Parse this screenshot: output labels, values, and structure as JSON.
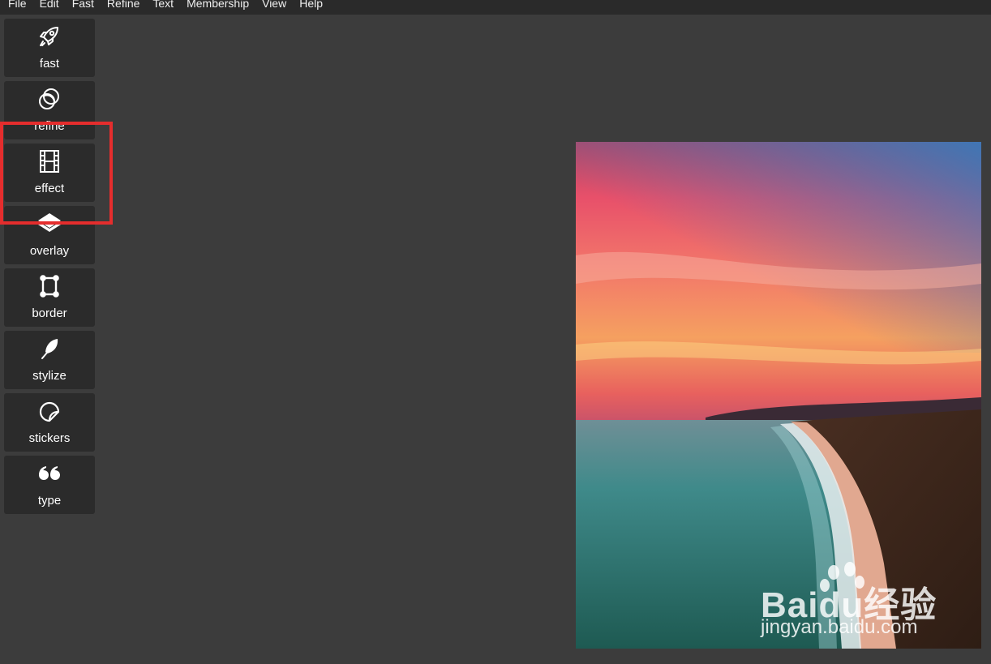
{
  "menubar": {
    "items": [
      {
        "label": "File"
      },
      {
        "label": "Edit"
      },
      {
        "label": "Fast"
      },
      {
        "label": "Refine"
      },
      {
        "label": "Text"
      },
      {
        "label": "Membership"
      },
      {
        "label": "View"
      },
      {
        "label": "Help"
      }
    ]
  },
  "toolbar": {
    "tools": [
      {
        "label": "fast",
        "icon": "rocket-icon"
      },
      {
        "label": "refine",
        "icon": "circles-icon"
      },
      {
        "label": "effect",
        "icon": "film-icon"
      },
      {
        "label": "overlay",
        "icon": "layers-icon"
      },
      {
        "label": "border",
        "icon": "frame-icon"
      },
      {
        "label": "stylize",
        "icon": "feather-icon"
      },
      {
        "label": "stickers",
        "icon": "sticker-icon"
      },
      {
        "label": "type",
        "icon": "quote-icon"
      }
    ]
  },
  "highlight": {
    "target": "effect",
    "color": "#e52d2d"
  },
  "watermark": {
    "brand": "Baidu经验",
    "url": "jingyan.baidu.com"
  },
  "colors": {
    "background": "#3c3c3c",
    "menubar": "#2a2a2a",
    "tool": "#2b2b2b"
  }
}
